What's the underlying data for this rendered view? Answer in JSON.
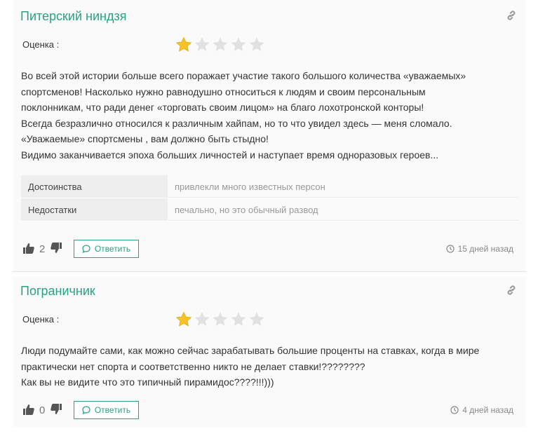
{
  "colors": {
    "accent": "#2aa085",
    "star_active": "#f7c325",
    "star_inactive": "#e1e1e1"
  },
  "reviews": [
    {
      "author": "Питерский ниндзя",
      "rating_label": "Оценка :",
      "rating": 1,
      "rating_max": 5,
      "text": [
        "Во всей этой истории больше всего поражает участие такого большого количества «уважаемых»",
        "спортсменов! Насколько нужно равнодушно относиться к людям и своим персональным",
        "поклонникам, что ради денег «торговать своим лицом» на благо лохотронской конторы!",
        "Всегда безразлично относился к различным хайпам, но то что увидел здесь — меня сломало.",
        "«Уважаемые» спортсмены , вам должно быть стыдно!",
        "Видимо заканчивается эпоха больших личностей и наступает время одноразовых героев..."
      ],
      "pros_label": "Достоинства",
      "pros": "привлекли много известных персон",
      "cons_label": "Недостатки",
      "cons": "печально, но это обычный развод",
      "likes": "2",
      "reply_label": "Ответить",
      "time": "15 дней назад"
    },
    {
      "author": "Пограничник",
      "rating_label": "Оценка :",
      "rating": 1,
      "rating_max": 5,
      "text": [
        "Люди подумайте сами, как можно сейчас зарабатывать большие проценты на ставках, когда в мире",
        "практически нет спорта и соответственно никто не делает ставки!????????",
        "Как вы не видите что это типичный пирамидос????!!!)))"
      ],
      "likes": "0",
      "reply_label": "Ответить",
      "time": "4 дней назад"
    }
  ],
  "icons": {
    "link": "link-icon",
    "thumbs_up": "thumbs-up-icon",
    "thumbs_down": "thumbs-down-icon",
    "reply": "comments-icon",
    "clock": "clock-icon",
    "star": "star-icon"
  }
}
